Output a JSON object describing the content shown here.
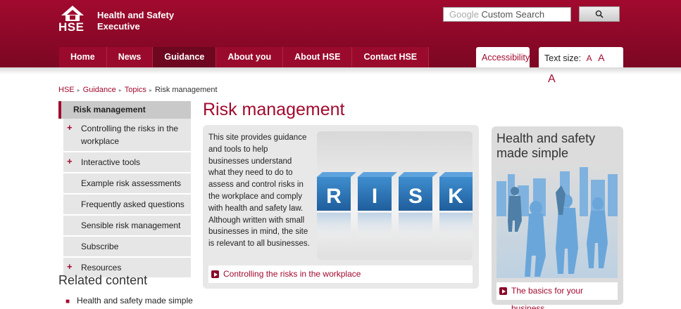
{
  "colors": {
    "brand": "#a10a2e",
    "nav_active": "#6e0720"
  },
  "header": {
    "logo_text": "HSE",
    "org_name": "Health and Safety Executive",
    "search": {
      "placeholder_brand": "Google",
      "placeholder": "Custom Search"
    }
  },
  "nav": {
    "items": [
      "Home",
      "News",
      "Guidance",
      "About you",
      "About HSE",
      "Contact HSE"
    ],
    "active": "Guidance"
  },
  "tools": {
    "accessibility": "Accessibility",
    "text_size_label": "Text size:",
    "sizes": [
      "A",
      "A",
      "A"
    ]
  },
  "breadcrumb": [
    "HSE",
    "Guidance",
    "Topics",
    "Risk management"
  ],
  "sidebar": {
    "heading": "Risk management",
    "items": [
      {
        "label": "Controlling the risks in the workplace",
        "expandable": true
      },
      {
        "label": "Interactive tools",
        "expandable": true
      },
      {
        "label": "Example risk assessments",
        "expandable": false
      },
      {
        "label": "Frequently asked questions",
        "expandable": false
      },
      {
        "label": "Sensible risk management",
        "expandable": false
      },
      {
        "label": "Subscribe",
        "expandable": false
      },
      {
        "label": "Resources",
        "expandable": true
      }
    ]
  },
  "related": {
    "title": "Related content",
    "items": [
      "Health and safety made simple"
    ]
  },
  "main": {
    "title": "Risk management",
    "intro": "This site provides guidance and tools to help businesses understand what they need to do to assess and control risks in the workplace and comply with health and safety law. Although written with small businesses in mind, the site is relevant to all businesses.",
    "image_letters": [
      "R",
      "I",
      "S",
      "K"
    ],
    "link": "Controlling the risks in the workplace"
  },
  "promo": {
    "title": "Health and safety made simple",
    "link": "The basics for your business"
  }
}
